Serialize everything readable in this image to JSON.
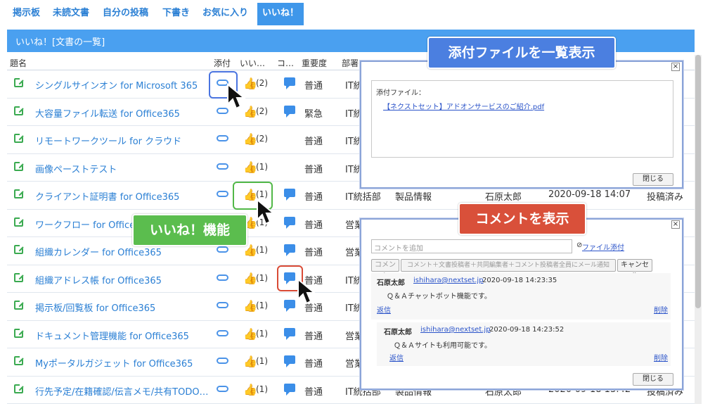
{
  "tabs": [
    "掲示板",
    "未読文書",
    "自分の投稿",
    "下書き",
    "お気に入り",
    "いいね！"
  ],
  "list_title": "いいね！[文書の一覧]",
  "columns": [
    "題名",
    "添付",
    "いい…",
    "コ…",
    "重要度",
    "部署"
  ],
  "rows": [
    {
      "title": "シングルサインオン for Microsoft 365",
      "likes": "(2)",
      "importance": "普通",
      "dept": "IT統"
    },
    {
      "title": "大容量ファイル転送 for Office365",
      "likes": "(2)",
      "importance": "緊急",
      "dept": "IT統"
    },
    {
      "title": "リモートワークツール for クラウド",
      "likes": "(2)",
      "importance": "普通",
      "dept": "IT統"
    },
    {
      "title": "画像ペーストテスト",
      "likes": "(1)",
      "importance": "普通",
      "dept": "IT統"
    },
    {
      "title": "クライアント証明書 for Office365",
      "likes": "(1)",
      "importance": "普通",
      "dept": "IT統括部",
      "extra1": "製品情報",
      "extra2": "石原太郎",
      "extra3": "2020-09-18 14:07",
      "extra4": "投稿済み"
    },
    {
      "title": "ワークフロー for Office365",
      "likes": "(1)",
      "importance": "普通",
      "dept": "営業"
    },
    {
      "title": "組織カレンダー for Office365",
      "likes": "(1)",
      "importance": "普通",
      "dept": "営業"
    },
    {
      "title": "組織アドレス帳 for Office365",
      "likes": "(1)",
      "importance": "普通",
      "dept": "IT統"
    },
    {
      "title": "掲示板/回覧板 for Office365",
      "likes": "(1)",
      "importance": "普通",
      "dept": "IT統"
    },
    {
      "title": "ドキュメント管理機能 for Office365",
      "likes": "(1)",
      "importance": "普通",
      "dept": "営業"
    },
    {
      "title": "Myポータルガジェット for Office365",
      "likes": "(1)",
      "importance": "普通",
      "dept": "営業"
    },
    {
      "title": "行先予定/在籍確認/伝言メモ/共有TODO…",
      "likes": "(1)",
      "importance": "普通",
      "dept": "IT統括部",
      "extra1": "製品情報",
      "extra2": "石原太郎",
      "extra3": "2020-09-18 13:42",
      "extra4": "投稿済み"
    }
  ],
  "callouts": {
    "attachment": "添付ファイルを一覧表示",
    "like": "いいね！機能",
    "comment": "コメントを表示"
  },
  "attach_popup": {
    "label": "添付ファイル：",
    "file": "【ネクストセット】アドオンサービスのご紹介.pdf",
    "close": "閉じる",
    "x": "×"
  },
  "comment_popup": {
    "placeholder": "コメントを追加",
    "file_attach": "ファイル添付",
    "comment_btn": "コメント",
    "notify_btn": "コメント＋文書投稿者＋共同編集者＋コメント投稿者全員にメール通知",
    "cancel": "キャンセル",
    "comments": [
      {
        "author": "石原太郎",
        "email": "ishihara@nextset.jp",
        "time": "2020-09-18 14:23:35",
        "body": "Ｑ＆Ａチャットボット機能です。",
        "reply": "返信",
        "delete": "削除"
      },
      {
        "author": "石原太郎",
        "email": "ishihara@nextset.jp",
        "time": "2020-09-18 14:23:52",
        "body": "Ｑ＆Ａサイトも利用可能です。",
        "reply": "返信",
        "delete": "削除"
      }
    ],
    "close": "閉じる",
    "x": "×"
  }
}
